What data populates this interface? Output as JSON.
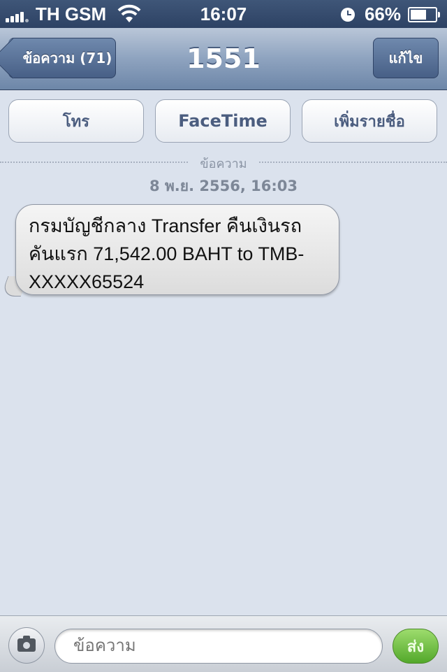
{
  "status_bar": {
    "carrier": "TH GSM",
    "time": "16:07",
    "battery_percent": "66%",
    "battery_level": 0.66
  },
  "nav": {
    "back_label": "ข้อความ (71)",
    "title": "1551",
    "edit_label": "แก้ไข"
  },
  "actions": {
    "call": "โทร",
    "facetime": "FaceTime",
    "add_contact": "เพิ่มรายชื่อ"
  },
  "thread": {
    "divider_label": "ข้อความ",
    "timestamp": "8 พ.ย. 2556, 16:03",
    "message": "กรมบัญชีกลาง Transfer คืนเงินรถคันแรก 71,542.00 BAHT to TMB-XXXXX65524"
  },
  "compose": {
    "placeholder": "ข้อความ",
    "send_label": "ส่ง"
  },
  "colors": {
    "background": "#dbe2ed",
    "nav_bar": "#8ea3bf",
    "send_green": "#5bb233"
  }
}
